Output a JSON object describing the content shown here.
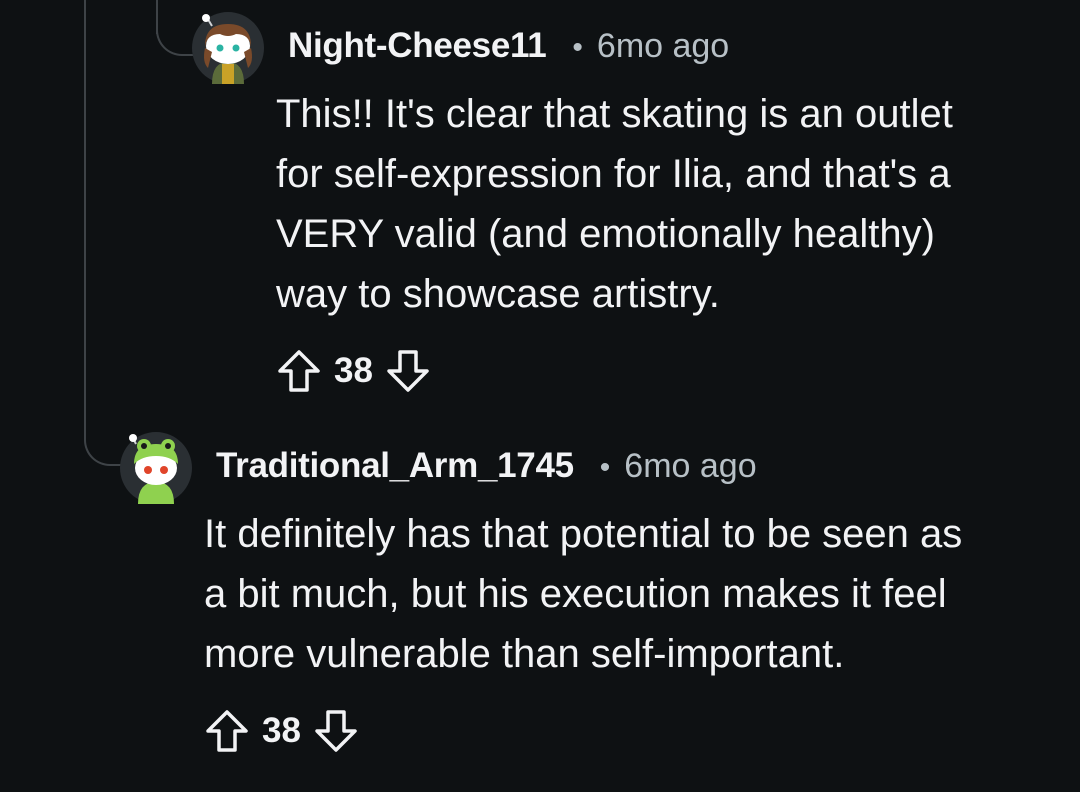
{
  "comments": [
    {
      "username": "Night-Cheese11",
      "separator": "•",
      "time": "6mo ago",
      "lines": [
        "This!! It's clear that skating is an outlet",
        "for self-expression for Ilia, and that's a",
        "VERY valid (and emotionally healthy)",
        "way to showcase artistry."
      ],
      "score": "38",
      "avatar_icon": "snoo-avatar-brown-hair-icon"
    },
    {
      "username": "Traditional_Arm_1745",
      "separator": "•",
      "time": "6mo ago",
      "lines": [
        "It definitely has that potential to be seen as",
        "a bit much, but his execution makes it feel",
        "more vulnerable than self-important."
      ],
      "score": "38",
      "avatar_icon": "snoo-avatar-green-hat-icon"
    }
  ],
  "icons": {
    "upvote": "upvote-arrow-icon",
    "downvote": "downvote-arrow-icon"
  },
  "colors": {
    "background": "#0e1113",
    "text": "#f2f3f5",
    "meta": "#b7c0c6",
    "thread_line": "#3e4347"
  }
}
